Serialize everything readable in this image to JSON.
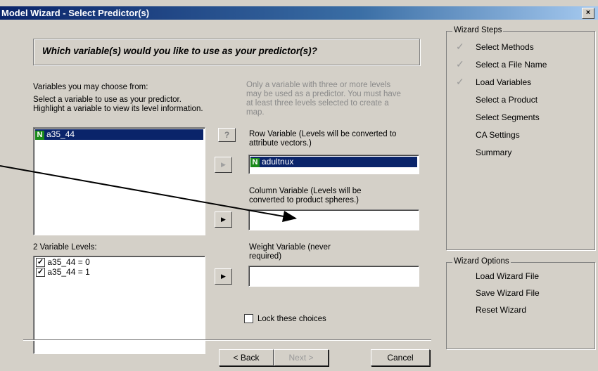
{
  "window": {
    "title": "Model Wizard - Select Predictor(s)",
    "close_label": "×"
  },
  "question": "Which variable(s) would you like to use as your predictor(s)?",
  "left": {
    "choose_label": "Variables you may choose from:",
    "instructions": "Select a variable to use as your predictor.  Highlight a variable to view its level information.",
    "variables": [
      {
        "type": "N",
        "name": "a35_44",
        "selected": true
      }
    ],
    "levels_label": "2 Variable Levels:",
    "levels": [
      {
        "label": "a35_44 = 0",
        "checked": true
      },
      {
        "label": "a35_44 = 1",
        "checked": true
      }
    ]
  },
  "middle": {
    "hint": "Only a variable with three or more levels may be used as a predictor. You must have at least three levels selected to create a map.",
    "help_label": "?",
    "row_label": "Row Variable (Levels will be converted to attribute vectors.)",
    "row_value": {
      "type": "N",
      "name": "adultnux"
    },
    "column_label": "Column Variable (Levels will be converted to product spheres.)",
    "column_value": "",
    "weight_label": "Weight Variable (never required)",
    "weight_value": "",
    "arrow": "▶",
    "lock_label": "Lock these choices"
  },
  "steps": {
    "title": "Wizard Steps",
    "items": [
      {
        "label": "Select Methods",
        "done": true
      },
      {
        "label": "Select a File Name",
        "done": true
      },
      {
        "label": "Load Variables",
        "done": true
      },
      {
        "label": "Select a Product",
        "done": false
      },
      {
        "label": "Select Segments",
        "done": false
      },
      {
        "label": "CA Settings",
        "done": false
      },
      {
        "label": "Summary",
        "done": false
      }
    ],
    "tick": "✓"
  },
  "options": {
    "title": "Wizard Options",
    "items": [
      "Load Wizard File",
      "Save Wizard File",
      "Reset Wizard"
    ]
  },
  "footer": {
    "back": "< Back",
    "next": "Next >",
    "cancel": "Cancel"
  },
  "colors": {
    "title_bar": "#0a246a",
    "dialog_bg": "#d4d0c8",
    "selection": "#0a246a",
    "numeric_icon": "#1a8a1a"
  }
}
